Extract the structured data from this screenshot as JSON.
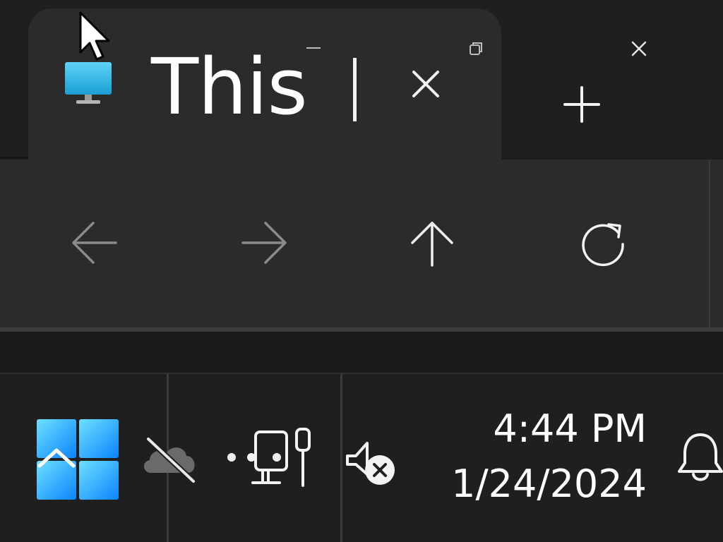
{
  "window": {
    "tab_title": "This",
    "tab_icon": "this-pc-icon",
    "controls": {
      "minimize_icon": "minimize-icon",
      "maximize_icon": "restore-icon",
      "close_icon": "close-icon",
      "new_tab_icon": "plus-icon",
      "tab_close_icon": "close-icon"
    }
  },
  "toolbar": {
    "buttons": [
      {
        "icon": "arrow-left-icon",
        "enabled": false
      },
      {
        "icon": "arrow-right-icon",
        "enabled": false
      },
      {
        "icon": "arrow-up-icon",
        "enabled": true
      },
      {
        "icon": "refresh-icon",
        "enabled": true
      }
    ]
  },
  "taskbar": {
    "start_icon": "windows-start-icon",
    "tray_icons": [
      "onedrive-offline-icon",
      "network-disconnected-icon",
      "volume-muted-icon",
      "notification-bell-icon"
    ],
    "clock": {
      "time": "4:44 PM",
      "date": "1/24/2024"
    }
  },
  "colors": {
    "accent": "#0a84ff",
    "background": "#1c1c1c",
    "surface": "#2b2b2b",
    "text": "#ffffff",
    "disabled": "#8a8a8a"
  }
}
